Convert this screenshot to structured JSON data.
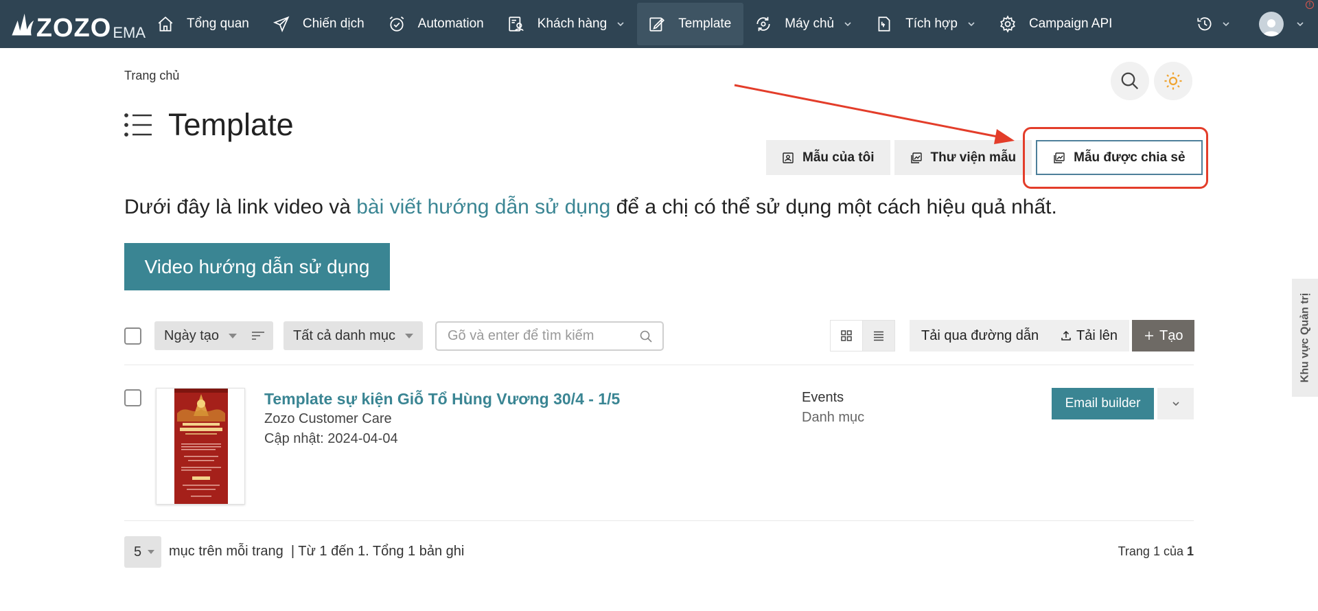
{
  "app": {
    "logo_text": "ZOZO",
    "logo_sub": "EMA"
  },
  "nav": {
    "items": [
      {
        "label": "Tổng quan"
      },
      {
        "label": "Chiến dịch"
      },
      {
        "label": "Automation"
      },
      {
        "label": "Khách hàng"
      },
      {
        "label": "Template"
      },
      {
        "label": "Máy chủ"
      },
      {
        "label": "Tích hợp"
      },
      {
        "label": "Campaign API"
      }
    ],
    "active": "Template",
    "notification_badge": "!"
  },
  "breadcrumb": {
    "home": "Trang chủ"
  },
  "page": {
    "title": "Template"
  },
  "tabs": [
    {
      "label": "Mẫu của tôi"
    },
    {
      "label": "Thư viện mẫu"
    },
    {
      "label": "Mẫu được chia sẻ"
    }
  ],
  "selected_tab": "Mẫu được chia sẻ",
  "intro": {
    "before": "Dưới đây là link video và ",
    "link": "bài viết hướng dẫn sử dụng",
    "after": " để a chị có thể sử dụng một cách hiệu quả nhất."
  },
  "video_button": "Video hướng dẫn sử dụng",
  "toolbar": {
    "sort_by": "Ngày tạo",
    "category_filter": "Tất cả danh mục",
    "search_placeholder": "Gõ và enter để tìm kiếm",
    "download_link": "Tải qua đường dẫn",
    "upload": "Tải lên",
    "create": "Tạo"
  },
  "templates": [
    {
      "title": "Template sự kiện Giỗ Tổ Hùng Vương 30/4 - 1/5",
      "author": "Zozo Customer Care",
      "updated": "Cập nhật: 2024-04-04",
      "category": "Events",
      "category_label": "Danh mục",
      "action": "Email builder"
    }
  ],
  "pagination": {
    "per_page": "5",
    "per_page_label": "mục trên mỗi trang",
    "range_text": "| Từ 1 đến 1. Tổng 1 bản ghi",
    "page_prefix": "Trang 1 của ",
    "total_pages": "1"
  },
  "side_tab": "Khu vực Quản trị",
  "colors": {
    "navbar": "#2f4453",
    "accent": "#3a8593",
    "highlight": "#e33d2a",
    "create_button": "#6e6a65"
  }
}
